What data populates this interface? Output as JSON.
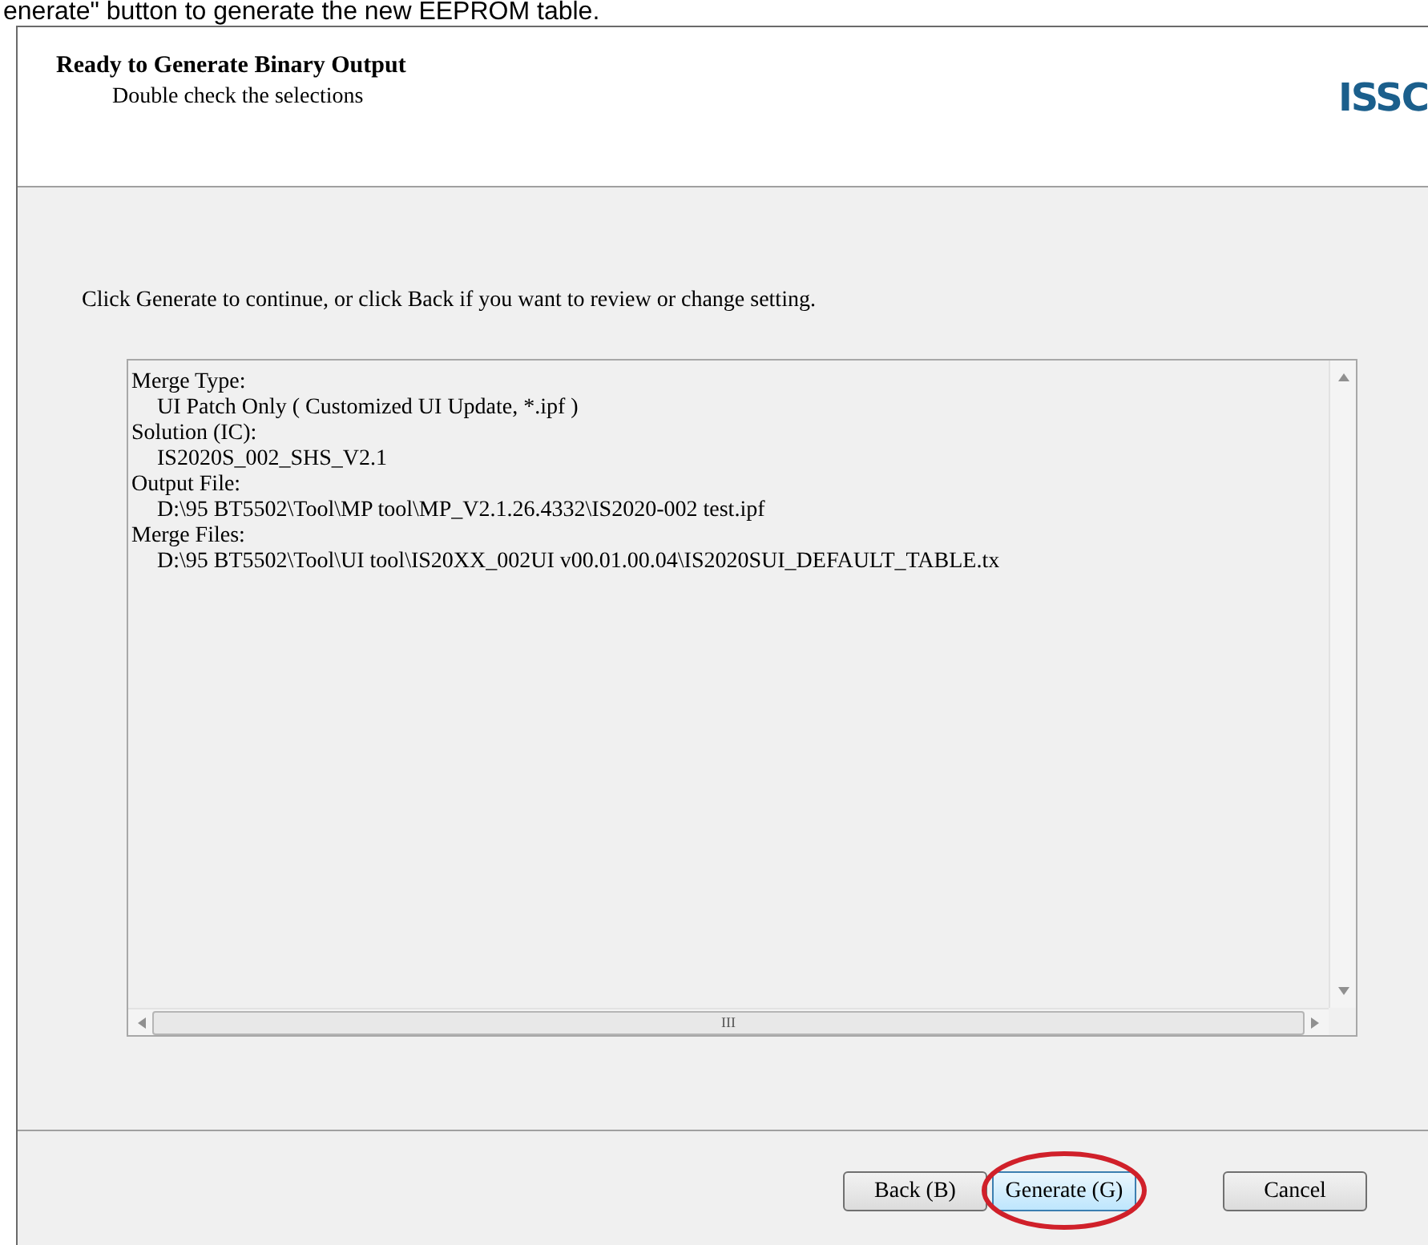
{
  "caption": "enerate\" button to generate the new EEPROM table.",
  "header": {
    "title": "Ready to Generate Binary Output",
    "subtitle": "Double check the selections",
    "logo": "ISSC"
  },
  "instruction": "Click Generate to continue, or click Back if you want to review or change setting.",
  "summary": [
    {
      "kind": "label",
      "text": "Merge Type:"
    },
    {
      "kind": "value",
      "text": "UI Patch Only ( Customized UI Update, *.ipf )"
    },
    {
      "kind": "label",
      "text": "Solution (IC):"
    },
    {
      "kind": "value",
      "text": "IS2020S_002_SHS_V2.1"
    },
    {
      "kind": "label",
      "text": "Output File:"
    },
    {
      "kind": "value",
      "text": "D:\\95 BT5502\\Tool\\MP tool\\MP_V2.1.26.4332\\IS2020-002 test.ipf"
    },
    {
      "kind": "label",
      "text": "Merge Files:"
    },
    {
      "kind": "value",
      "text": "D:\\95 BT5502\\Tool\\UI tool\\IS20XX_002UI v00.01.00.04\\IS2020SUI_DEFAULT_TABLE.tx"
    }
  ],
  "scroll_grip": "III",
  "buttons": [
    {
      "label": "Back (B)",
      "highlighted": false
    },
    {
      "label": "Generate (G)",
      "highlighted": true
    },
    {
      "label": "Cancel",
      "highlighted": false
    }
  ]
}
